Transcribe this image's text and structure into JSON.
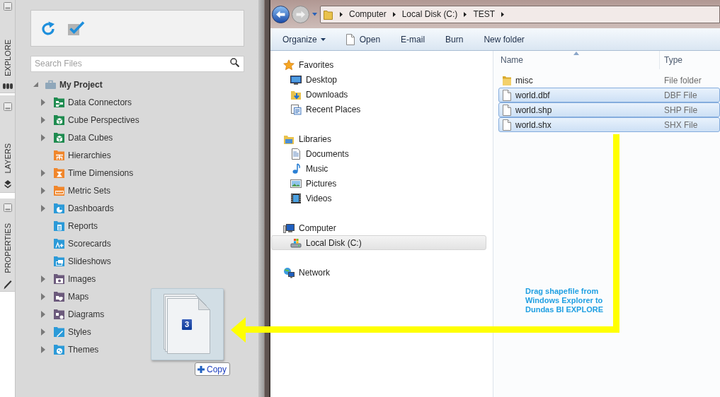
{
  "side_tabs": [
    {
      "label": "EXPLORE"
    },
    {
      "label": "LAYERS"
    },
    {
      "label": "PROPERTIES"
    }
  ],
  "explore_panel": {
    "search": {
      "placeholder": "Search Files"
    },
    "tree": {
      "label": "My Project",
      "expanded": true,
      "children": [
        {
          "label": "Data Connectors",
          "kind": "group",
          "expanded": false,
          "color": "#1e8b4f"
        },
        {
          "label": "Cube Perspectives",
          "kind": "group",
          "expanded": false,
          "color": "#1e8b4f"
        },
        {
          "label": "Data Cubes",
          "kind": "group",
          "expanded": false,
          "color": "#1e8b4f"
        },
        {
          "label": "Hierarchies",
          "kind": "leaf",
          "color": "#f0862b"
        },
        {
          "label": "Time Dimensions",
          "kind": "group",
          "expanded": false,
          "color": "#f0862b"
        },
        {
          "label": "Metric Sets",
          "kind": "group",
          "expanded": false,
          "color": "#f0862b"
        },
        {
          "label": "Dashboards",
          "kind": "group",
          "expanded": false,
          "color": "#2b9ad8"
        },
        {
          "label": "Reports",
          "kind": "leaf",
          "color": "#2b9ad8"
        },
        {
          "label": "Scorecards",
          "kind": "leaf",
          "color": "#2b9ad8"
        },
        {
          "label": "Slideshows",
          "kind": "leaf",
          "color": "#2b9ad8"
        },
        {
          "label": "Images",
          "kind": "group",
          "expanded": false,
          "color": "#6c5a7c"
        },
        {
          "label": "Maps",
          "kind": "group",
          "expanded": false,
          "color": "#6c5a7c"
        },
        {
          "label": "Diagrams",
          "kind": "group",
          "expanded": false,
          "color": "#6c5a7c"
        },
        {
          "label": "Styles",
          "kind": "group",
          "expanded": false,
          "color": "#2b9ad8"
        },
        {
          "label": "Themes",
          "kind": "group",
          "expanded": false,
          "color": "#2b9ad8"
        }
      ]
    }
  },
  "drag_preview": {
    "count": "3",
    "effect": "Copy"
  },
  "explorer": {
    "breadcrumb": [
      "Computer",
      "Local Disk (C:)",
      "TEST"
    ],
    "toolbar": [
      {
        "label": "Organize",
        "kind": "dropdown"
      },
      {
        "label": "Open",
        "kind": "icon"
      },
      {
        "label": "E-mail",
        "kind": "plain"
      },
      {
        "label": "Burn",
        "kind": "plain"
      },
      {
        "label": "New folder",
        "kind": "plain"
      }
    ],
    "navigation": [
      {
        "label": "Favorites",
        "selected": false,
        "children": [
          {
            "label": "Desktop",
            "selected": false
          },
          {
            "label": "Downloads",
            "selected": false
          },
          {
            "label": "Recent Places",
            "selected": false
          }
        ]
      },
      {
        "label": "Libraries",
        "selected": false,
        "children": [
          {
            "label": "Documents",
            "selected": false
          },
          {
            "label": "Music",
            "selected": false
          },
          {
            "label": "Pictures",
            "selected": false
          },
          {
            "label": "Videos",
            "selected": false
          }
        ]
      },
      {
        "label": "Computer",
        "selected": false,
        "children": [
          {
            "label": "Local Disk (C:)",
            "selected": true
          }
        ]
      },
      {
        "label": "Network",
        "selected": false
      }
    ],
    "columns": [
      {
        "label": "Name",
        "sorted": true
      },
      {
        "label": "Type",
        "sorted": false
      }
    ],
    "files": [
      {
        "name": "misc",
        "type": "File folder",
        "kind": "folder",
        "selected": false
      },
      {
        "name": "world.dbf",
        "type": "DBF File",
        "kind": "file",
        "selected": true
      },
      {
        "name": "world.shp",
        "type": "SHP File",
        "kind": "file",
        "selected": true
      },
      {
        "name": "world.shx",
        "type": "SHX File",
        "kind": "file",
        "selected": true
      }
    ]
  },
  "annotation": {
    "lines": [
      "Drag shapefile from",
      "Windows Explorer to",
      "Dundas BI EXPLORE"
    ]
  }
}
